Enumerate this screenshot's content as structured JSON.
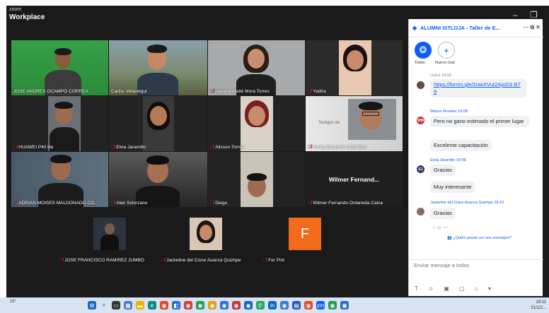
{
  "window": {
    "zoom_logo": "zoom",
    "app_title": "Workplace",
    "minimize": "–",
    "restore": "❐"
  },
  "participants": [
    {
      "name": "JOSE ANDRES OCAMPO CORREA",
      "muted": false
    },
    {
      "name": "Carlos Velastegui",
      "muted": false
    },
    {
      "name": "Dayana Maité Mora Torres",
      "muted": true
    },
    {
      "name": "Yadira",
      "muted": true
    },
    {
      "name": "HUAWEI P40 lite",
      "muted": true
    },
    {
      "name": "Elvia Jaramillo",
      "muted": true
    },
    {
      "name": "Alisson Torres",
      "muted": true
    },
    {
      "name": "Jenny Elizabeth Ortiz Ruiz",
      "muted": true
    },
    {
      "name": "ADRIAN MOISES MALDONADO CO...",
      "muted": true
    },
    {
      "name": "Alan Solorzano",
      "muted": true
    },
    {
      "name": "Diego",
      "muted": true
    },
    {
      "name": "Wilmer Fernando Ontaneda Calva",
      "muted": true
    },
    {
      "name": "JOSE FRANCISCO RAMIREZ JUMBO",
      "muted": true
    },
    {
      "name": "Jackeline del Cisne Asanza Quizhpe",
      "muted": true
    },
    {
      "name": "Fer Pint",
      "muted": true
    }
  ],
  "camera_off_name": "Wilmer Fernand...",
  "avatar_letter": "F",
  "slide_text": "Testigos de",
  "chat": {
    "title": "ALUMNI ISTLOJA - Taller de E...",
    "tab_all": "Todos",
    "tab_new": "Nuevo chat",
    "partial_top": "Usted 19:08",
    "link": "https://forms.gle/2raxXVut2AjsGS B79",
    "messages": [
      {
        "sender": "Wilson Morales 19:08",
        "initials": "WM",
        "text": "Pero no gano estimado el primer lugar"
      },
      {
        "text": "Excelente capacitación"
      },
      {
        "sender": "Elvia Jaramillo 19:09",
        "initials": "EJ",
        "text": "Gracias"
      },
      {
        "text": "Muy interesante"
      },
      {
        "sender": "Jackeline del Cisne Asanza Quizhpe 19:10",
        "text": "Gracias"
      }
    ],
    "who_can_see": "¿Quién puede ver sus mensajes?",
    "input_placeholder": "Enviar mensaje a todos"
  },
  "taskbar": {
    "weather": "16°",
    "time": "19:11",
    "date": "21/1/2..."
  },
  "colors": {
    "zoom_blue": "#0b5cff",
    "active_speaker": "#3dd68c",
    "muted_red": "#e33333",
    "avatar_orange": "#f26a1b"
  }
}
